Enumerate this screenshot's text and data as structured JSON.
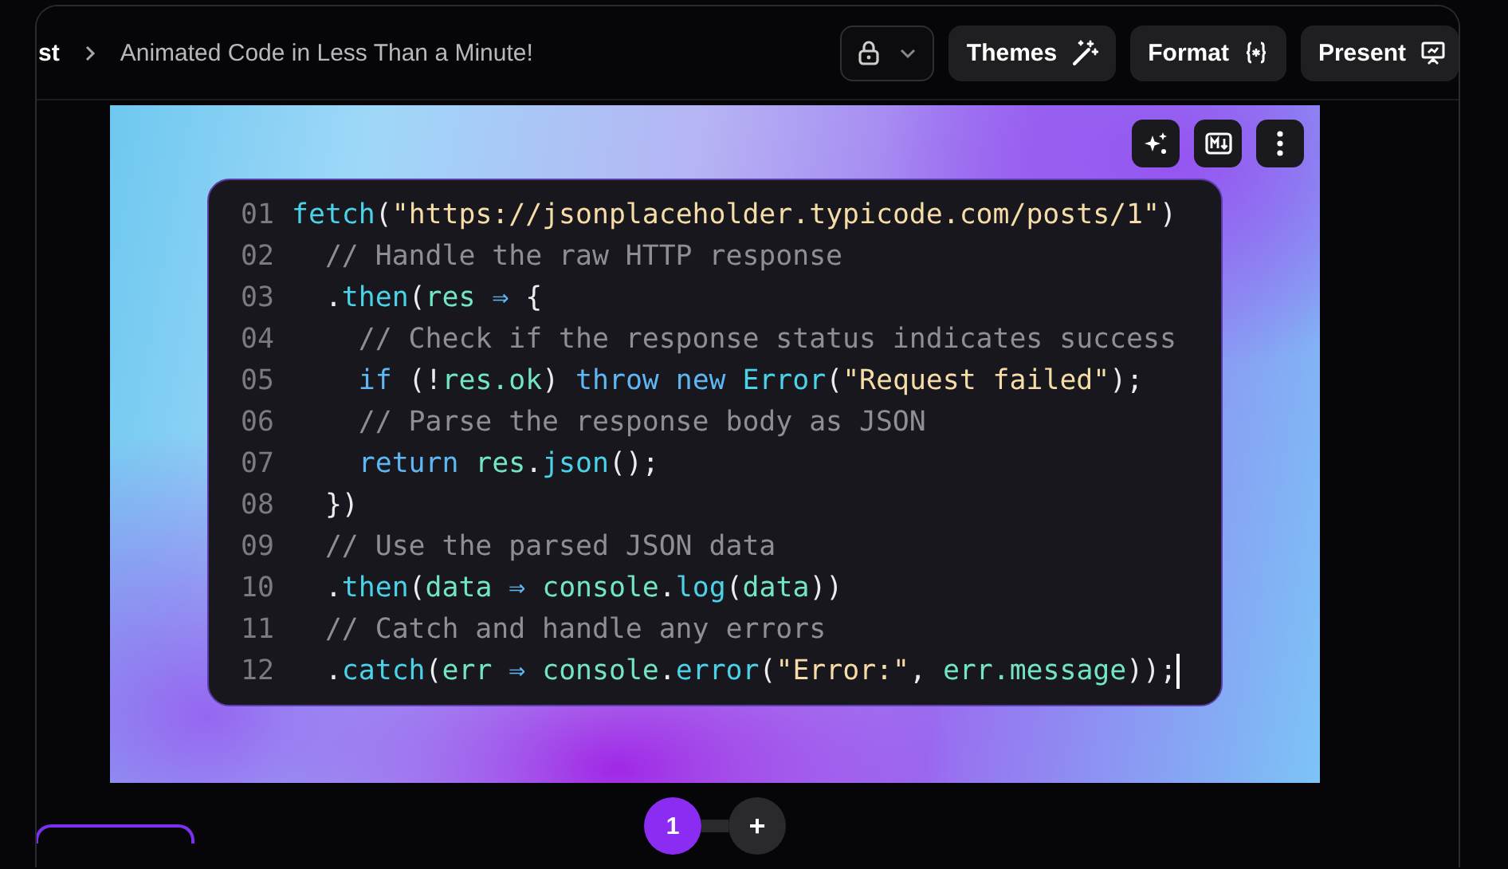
{
  "header": {
    "breadcrumb_parent": "st",
    "title": "Animated Code in Less Than a Minute!",
    "buttons": [
      {
        "kind": "lock"
      },
      {
        "kind": "themes",
        "label": "Themes"
      },
      {
        "kind": "format",
        "label": "Format"
      },
      {
        "kind": "present",
        "label": "Present"
      }
    ]
  },
  "canvas_tools": [
    {
      "kind": "sparkle"
    },
    {
      "kind": "markdown"
    },
    {
      "kind": "more"
    }
  ],
  "code": {
    "lines": [
      {
        "number": "01",
        "tokens": [
          {
            "kind": "fn",
            "text": "fetch"
          },
          {
            "kind": "punct",
            "text": "("
          },
          {
            "kind": "str",
            "text": "\"https://jsonplaceholder.typicode.com/posts/1\""
          },
          {
            "kind": "punct",
            "text": ")"
          }
        ]
      },
      {
        "number": "02",
        "tokens": [
          {
            "kind": "comment",
            "text": "  // Handle the raw HTTP response"
          }
        ]
      },
      {
        "number": "03",
        "tokens": [
          {
            "kind": "punct",
            "text": "  ."
          },
          {
            "kind": "fn",
            "text": "then"
          },
          {
            "kind": "punct",
            "text": "("
          },
          {
            "kind": "var",
            "text": "res"
          },
          {
            "kind": "keyword",
            "text": " ⇒"
          },
          {
            "kind": "punct",
            "text": " {"
          }
        ]
      },
      {
        "number": "04",
        "tokens": [
          {
            "kind": "comment",
            "text": "    // Check if the response status indicates success"
          }
        ]
      },
      {
        "number": "05",
        "tokens": [
          {
            "kind": "keyword",
            "text": "    if"
          },
          {
            "kind": "punct",
            "text": " (!"
          },
          {
            "kind": "var",
            "text": "res.ok"
          },
          {
            "kind": "punct",
            "text": ") "
          },
          {
            "kind": "keyword",
            "text": "throw new "
          },
          {
            "kind": "fn",
            "text": "Error"
          },
          {
            "kind": "punct",
            "text": "("
          },
          {
            "kind": "str",
            "text": "\"Request failed\""
          },
          {
            "kind": "punct",
            "text": ");"
          }
        ]
      },
      {
        "number": "06",
        "tokens": [
          {
            "kind": "comment",
            "text": "    // Parse the response body as JSON"
          }
        ]
      },
      {
        "number": "07",
        "tokens": [
          {
            "kind": "keyword",
            "text": "    return "
          },
          {
            "kind": "var",
            "text": "res"
          },
          {
            "kind": "punct",
            "text": "."
          },
          {
            "kind": "fn",
            "text": "json"
          },
          {
            "kind": "punct",
            "text": "();"
          }
        ]
      },
      {
        "number": "08",
        "tokens": [
          {
            "kind": "punct",
            "text": "  })"
          }
        ]
      },
      {
        "number": "09",
        "tokens": [
          {
            "kind": "comment",
            "text": "  // Use the parsed JSON data"
          }
        ]
      },
      {
        "number": "10",
        "tokens": [
          {
            "kind": "punct",
            "text": "  ."
          },
          {
            "kind": "fn",
            "text": "then"
          },
          {
            "kind": "punct",
            "text": "("
          },
          {
            "kind": "var",
            "text": "data"
          },
          {
            "kind": "keyword",
            "text": " ⇒ "
          },
          {
            "kind": "var",
            "text": "console"
          },
          {
            "kind": "punct",
            "text": "."
          },
          {
            "kind": "fn",
            "text": "log"
          },
          {
            "kind": "punct",
            "text": "("
          },
          {
            "kind": "var",
            "text": "data"
          },
          {
            "kind": "punct",
            "text": "))"
          }
        ]
      },
      {
        "number": "11",
        "tokens": [
          {
            "kind": "comment",
            "text": "  // Catch and handle any errors"
          }
        ]
      },
      {
        "number": "12",
        "tokens": [
          {
            "kind": "punct",
            "text": "  ."
          },
          {
            "kind": "fn",
            "text": "catch"
          },
          {
            "kind": "punct",
            "text": "("
          },
          {
            "kind": "var",
            "text": "err"
          },
          {
            "kind": "keyword",
            "text": " ⇒ "
          },
          {
            "kind": "var",
            "text": "console"
          },
          {
            "kind": "punct",
            "text": "."
          },
          {
            "kind": "fn",
            "text": "error"
          },
          {
            "kind": "punct",
            "text": "("
          },
          {
            "kind": "str",
            "text": "\"Error:\""
          },
          {
            "kind": "punct",
            "text": ", "
          },
          {
            "kind": "var",
            "text": "err.message"
          },
          {
            "kind": "punct",
            "text": "));"
          }
        ]
      }
    ]
  },
  "pages": [
    {
      "label": "1",
      "selected": true
    }
  ],
  "add_page": {
    "label": "+"
  }
}
